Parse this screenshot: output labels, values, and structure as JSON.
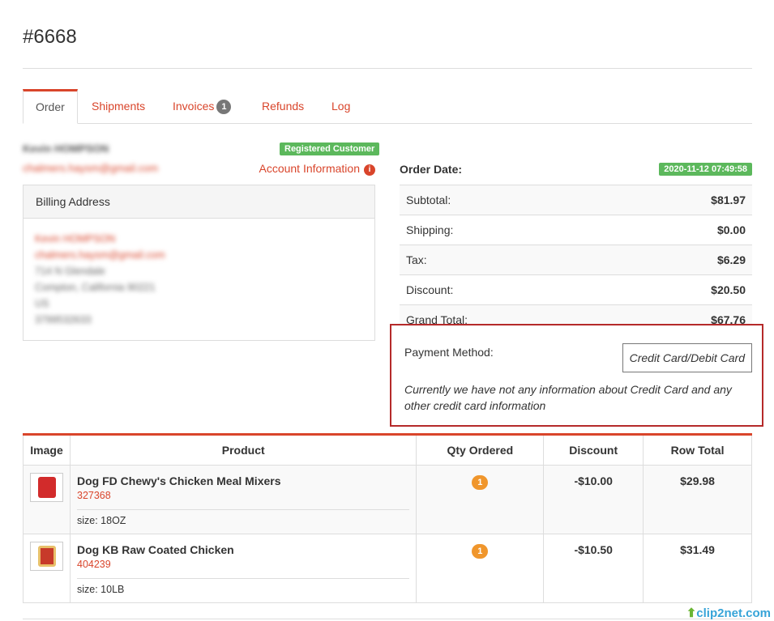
{
  "order": {
    "title": "#6668"
  },
  "tabs": [
    {
      "label": "Order"
    },
    {
      "label": "Shipments"
    },
    {
      "label": "Invoices",
      "badge": "1"
    },
    {
      "label": "Refunds"
    },
    {
      "label": "Log"
    }
  ],
  "customer": {
    "name": "Kevin HOMPSON",
    "email": "chalmers.haysm@gmail.com",
    "badge": "Registered Customer",
    "account_link": "Account Information"
  },
  "billing": {
    "heading": "Billing Address",
    "lines": [
      "Kevin HOMPSON",
      "chalmers.haysm@gmail.com",
      "714 N Glendale",
      "Compton, California 90221",
      "US",
      "3799532633"
    ]
  },
  "summary": {
    "order_date_label": "Order Date:",
    "order_date": "2020-11-12 07:49:58",
    "rows": [
      {
        "label": "Subtotal:",
        "value": "$81.97"
      },
      {
        "label": "Shipping:",
        "value": "$0.00"
      },
      {
        "label": "Tax:",
        "value": "$6.29"
      },
      {
        "label": "Discount:",
        "value": "$20.50"
      },
      {
        "label": "Grand Total:",
        "value": "$67.76"
      }
    ]
  },
  "payment": {
    "label": "Payment Method:",
    "method": "Credit Card/Debit Card",
    "note": "Currently we have not any information about Credit Card and any other credit card information"
  },
  "items": {
    "headers": [
      "Image",
      "Product",
      "Qty Ordered",
      "Discount",
      "Row Total"
    ],
    "rows": [
      {
        "name": "Dog FD Chewy's Chicken Meal Mixers",
        "sku": "327368",
        "option": "size: 18OZ",
        "qty": "1",
        "discount": "-$10.00",
        "total": "$29.98"
      },
      {
        "name": "Dog KB Raw Coated Chicken",
        "sku": "404239",
        "option": "size: 10LB",
        "qty": "1",
        "discount": "-$10.50",
        "total": "$31.49"
      }
    ]
  },
  "watermark": {
    "text": "clip2net.com"
  },
  "colors": {
    "accent": "#d9452b",
    "success": "#5cb85c",
    "qty_badge": "#f0962c",
    "highlight_border": "#b52a2a"
  }
}
